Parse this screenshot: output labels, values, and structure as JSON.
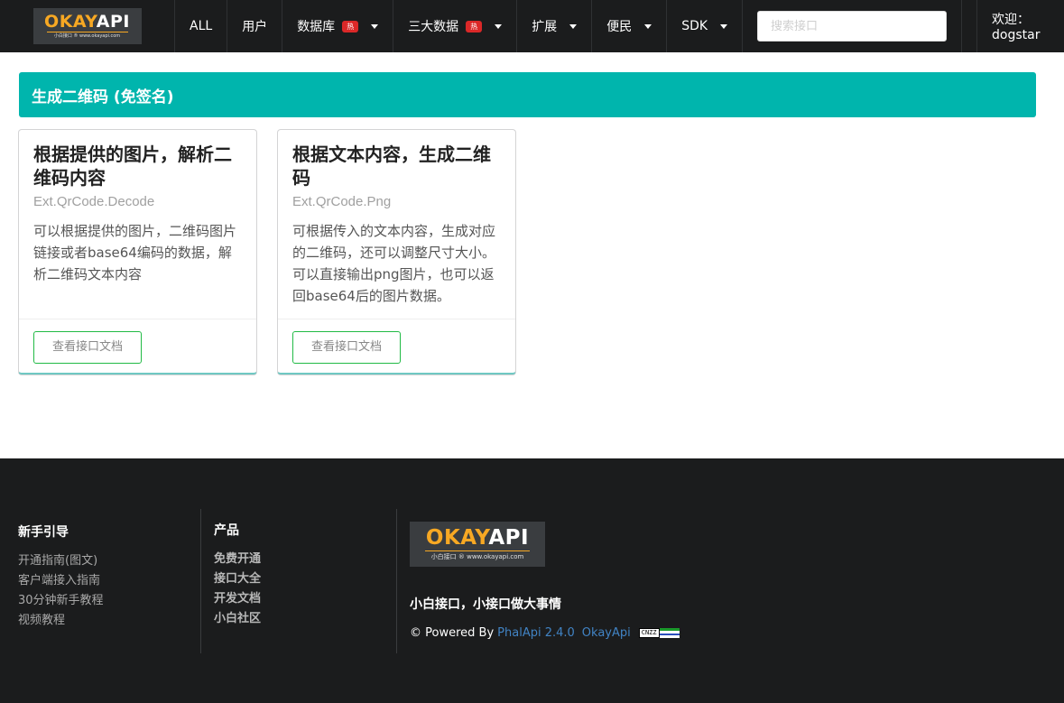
{
  "brand": {
    "logo_okay": "OKAY",
    "logo_api": "API",
    "logo_sub": "小白接口 ® www.okayapi.com"
  },
  "nav": {
    "items": [
      {
        "label": "ALL"
      },
      {
        "label": "用户"
      },
      {
        "label": "数据库",
        "badge": "热",
        "dropdown": true
      },
      {
        "label": "三大数据",
        "badge": "热",
        "dropdown": true
      },
      {
        "label": "扩展",
        "dropdown": true
      },
      {
        "label": "便民",
        "dropdown": true
      },
      {
        "label": "SDK",
        "dropdown": true
      }
    ],
    "search_placeholder": "搜索接口",
    "welcome": "欢迎：dogstar"
  },
  "main": {
    "section_title": "生成二维码 (免签名)",
    "cards": [
      {
        "title": "根据提供的图片，解析二维码内容",
        "api": "Ext.QrCode.Decode",
        "description": "可以根据提供的图片，二维码图片链接或者base64编码的数据，解析二维码文本内容",
        "button": "查看接口文档"
      },
      {
        "title": "根据文本内容，生成二维码",
        "api": "Ext.QrCode.Png",
        "description": "可根据传入的文本内容，生成对应的二维码，还可以调整尺寸大小。可以直接输出png图片，也可以返回base64后的图片数据。",
        "button": "查看接口文档"
      }
    ]
  },
  "footer": {
    "guide": {
      "title": "新手引导",
      "links": [
        "开通指南(图文)",
        "客户端接入指南",
        "30分钟新手教程",
        "视频教程"
      ]
    },
    "product": {
      "title": "产品",
      "links": [
        "免费开通",
        "接口大全",
        "开发文档",
        "小白社区"
      ]
    },
    "slogan": "小白接口，小接口做大事情",
    "powered_prefix": "© Powered By",
    "phalapi": "PhalApi 2.4.0",
    "okayapi": "OkayApi",
    "cnzz_label": "CNZZ",
    "cnzz_colors": [
      "#1a9a2a",
      "#ffffff",
      "#2d4fbd",
      "#ffffff"
    ]
  },
  "colors": {
    "navbar_bg": "#1b1c1d",
    "accent_teal": "#00b5ad",
    "button_border_green": "#21ba45",
    "badge_red": "#db2828",
    "logo_orange": "#f7a823",
    "link_blue": "#4183c4"
  }
}
